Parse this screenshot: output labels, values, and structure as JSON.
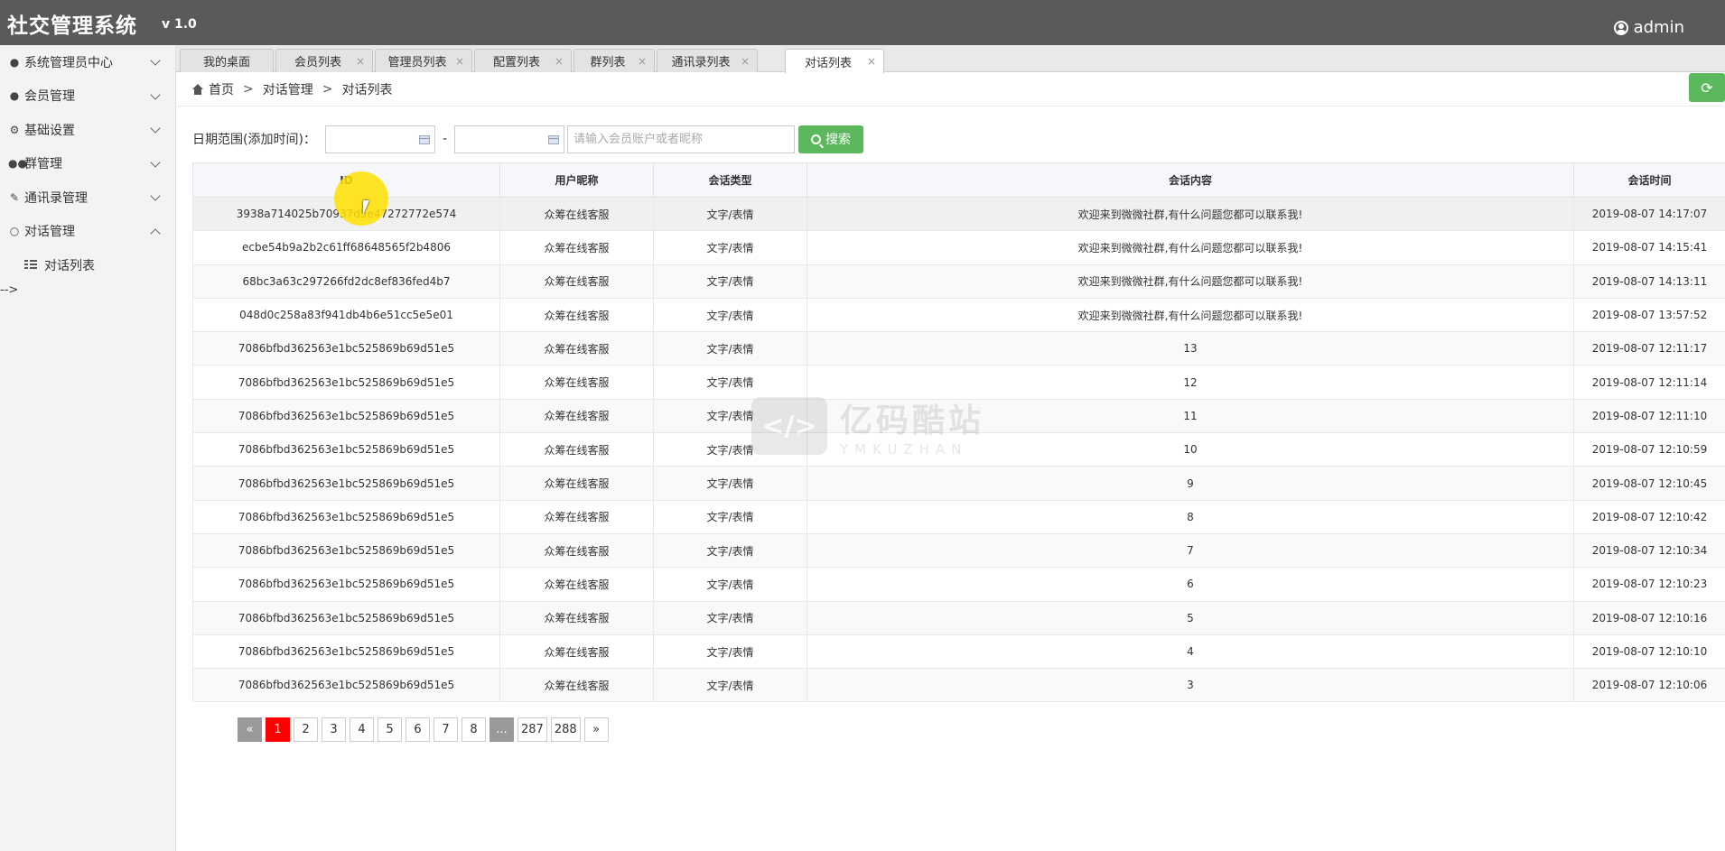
{
  "header": {
    "brand": "社交管理系统",
    "version": "v 1.0",
    "user": "admin"
  },
  "sidebar": {
    "items": [
      {
        "label": "系统管理员中心",
        "icon": "user-icon"
      },
      {
        "label": "会员管理",
        "icon": "user-icon"
      },
      {
        "label": "基础设置",
        "icon": "gear-icon"
      },
      {
        "label": "群管理",
        "icon": "group-icon"
      },
      {
        "label": "通讯录管理",
        "icon": "edit-icon"
      },
      {
        "label": "对话管理",
        "icon": "chat-icon"
      }
    ],
    "sub_items": [
      {
        "label": "对话列表",
        "icon": "list-icon"
      }
    ],
    "stray_text": "-->"
  },
  "tabs": [
    {
      "label": "我的桌面"
    },
    {
      "label": "会员列表"
    },
    {
      "label": "管理员列表"
    },
    {
      "label": "配置列表"
    },
    {
      "label": "群列表"
    },
    {
      "label": "通讯录列表"
    },
    {
      "label": "对话列表"
    }
  ],
  "tab_close": "×",
  "breadcrumb": {
    "home": "首页",
    "sep": ">",
    "level1": "对话管理",
    "level2": "对话列表"
  },
  "filter": {
    "label": "日期范围(添加时间)：",
    "dash": "-",
    "placeholder": "请输入会员账户或者昵称",
    "search_label": "搜索"
  },
  "table": {
    "headers": [
      "ID",
      "用户昵称",
      "会话类型",
      "会话内容",
      "会话时间"
    ],
    "rows": [
      [
        "3938a714025b70937d5e47272772e574",
        "众筹在线客服",
        "文字/表情",
        "欢迎来到微微社群,有什么问题您都可以联系我!",
        "2019-08-07 14:17:07"
      ],
      [
        "ecbe54b9a2b2c61ff68648565f2b4806",
        "众筹在线客服",
        "文字/表情",
        "欢迎来到微微社群,有什么问题您都可以联系我!",
        "2019-08-07 14:15:41"
      ],
      [
        "68bc3a63c297266fd2dc8ef836fed4b7",
        "众筹在线客服",
        "文字/表情",
        "欢迎来到微微社群,有什么问题您都可以联系我!",
        "2019-08-07 14:13:11"
      ],
      [
        "048d0c258a83f941db4b6e51cc5e5e01",
        "众筹在线客服",
        "文字/表情",
        "欢迎来到微微社群,有什么问题您都可以联系我!",
        "2019-08-07 13:57:52"
      ],
      [
        "7086bfbd362563e1bc525869b69d51e5",
        "众筹在线客服",
        "文字/表情",
        "13",
        "2019-08-07 12:11:17"
      ],
      [
        "7086bfbd362563e1bc525869b69d51e5",
        "众筹在线客服",
        "文字/表情",
        "12",
        "2019-08-07 12:11:14"
      ],
      [
        "7086bfbd362563e1bc525869b69d51e5",
        "众筹在线客服",
        "文字/表情",
        "11",
        "2019-08-07 12:11:10"
      ],
      [
        "7086bfbd362563e1bc525869b69d51e5",
        "众筹在线客服",
        "文字/表情",
        "10",
        "2019-08-07 12:10:59"
      ],
      [
        "7086bfbd362563e1bc525869b69d51e5",
        "众筹在线客服",
        "文字/表情",
        "9",
        "2019-08-07 12:10:45"
      ],
      [
        "7086bfbd362563e1bc525869b69d51e5",
        "众筹在线客服",
        "文字/表情",
        "8",
        "2019-08-07 12:10:42"
      ],
      [
        "7086bfbd362563e1bc525869b69d51e5",
        "众筹在线客服",
        "文字/表情",
        "7",
        "2019-08-07 12:10:34"
      ],
      [
        "7086bfbd362563e1bc525869b69d51e5",
        "众筹在线客服",
        "文字/表情",
        "6",
        "2019-08-07 12:10:23"
      ],
      [
        "7086bfbd362563e1bc525869b69d51e5",
        "众筹在线客服",
        "文字/表情",
        "5",
        "2019-08-07 12:10:16"
      ],
      [
        "7086bfbd362563e1bc525869b69d51e5",
        "众筹在线客服",
        "文字/表情",
        "4",
        "2019-08-07 12:10:10"
      ],
      [
        "7086bfbd362563e1bc525869b69d51e5",
        "众筹在线客服",
        "文字/表情",
        "3",
        "2019-08-07 12:10:06"
      ]
    ]
  },
  "pagination": {
    "prev": "«",
    "pages": [
      "1",
      "2",
      "3",
      "4",
      "5",
      "6",
      "7",
      "8"
    ],
    "ellipsis": "...",
    "tail_pages": [
      "287",
      "288"
    ],
    "next": "»",
    "current": "1"
  },
  "watermark": {
    "cn": "亿码酷站",
    "en": "YMKUZHAN"
  },
  "colors": {
    "header_bg": "#5a5a5a",
    "accent_green": "#5cb85c",
    "current_page": "#ff0000"
  }
}
